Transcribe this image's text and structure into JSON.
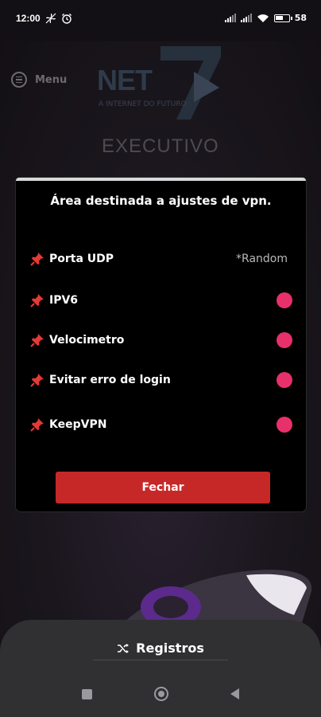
{
  "status_bar": {
    "time": "12:00",
    "battery_percent": "58",
    "icons": [
      "fan-icon",
      "alarm-icon",
      "signal-icon",
      "signal-icon",
      "wifi-icon",
      "battery-icon"
    ]
  },
  "background_app": {
    "menu_label": "Menu",
    "logo_net": "NET",
    "logo_tagline": "A INTERNET DO FUTURO",
    "logo_executivo": "EXECUTIVO"
  },
  "dialog": {
    "title": "Área destinada a ajustes de vpn.",
    "options": [
      {
        "label": "Porta UDP",
        "value": "*Random",
        "icon": "pin-icon"
      },
      {
        "label": "IPV6",
        "icon": "pin-icon",
        "toggle": true
      },
      {
        "label": "Velocimetro",
        "icon": "pin-icon",
        "toggle": true
      },
      {
        "label": "Evitar erro de login",
        "icon": "pin-icon",
        "toggle": true
      },
      {
        "label": "KeepVPN",
        "icon": "pin-icon",
        "toggle": true
      }
    ],
    "close_label": "Fechar"
  },
  "bottom": {
    "registros_label": "Registros",
    "registros_icon": "shuffle-icon"
  },
  "colors": {
    "accent_toggle": "#e8306a",
    "button_red": "#c62828",
    "dialog_bg": "#000000"
  }
}
